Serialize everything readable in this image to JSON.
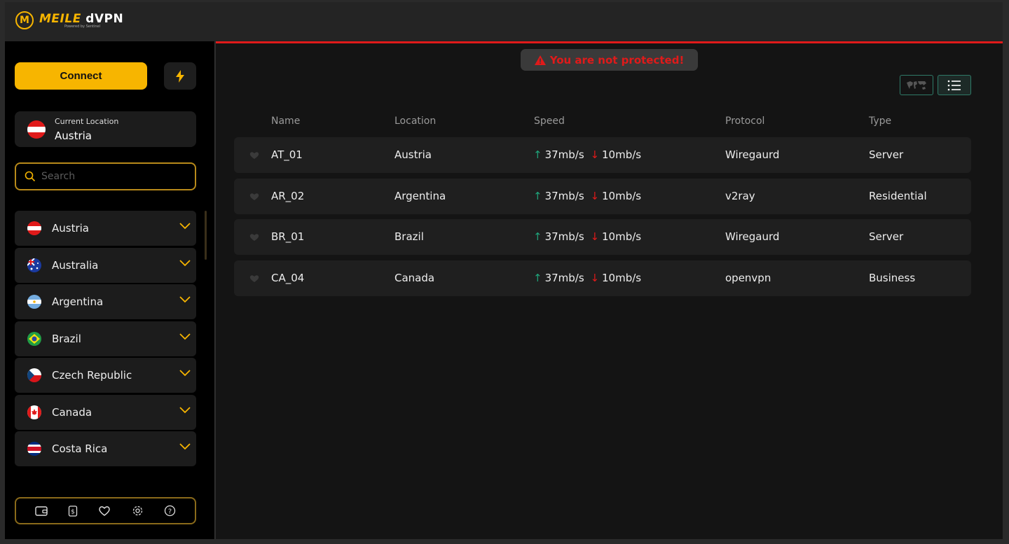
{
  "app": {
    "logo_letter": "M",
    "brand_left": "MEILE",
    "brand_right": "dVPN",
    "tagline": "Powered by Sentinel"
  },
  "sidebar": {
    "connect_label": "Connect",
    "current_location_label": "Current Location",
    "current_location_value": "Austria",
    "search_placeholder": "Search",
    "countries": [
      {
        "name": "Austria"
      },
      {
        "name": "Australia"
      },
      {
        "name": "Argentina"
      },
      {
        "name": "Brazil"
      },
      {
        "name": "Czech Republic"
      },
      {
        "name": "Canada"
      },
      {
        "name": "Costa Rica"
      }
    ],
    "bottom_icons": [
      "wallet-icon",
      "dollar-icon",
      "heart-icon",
      "gear-icon",
      "help-icon"
    ]
  },
  "main": {
    "alert_text": "You are not protected!",
    "columns": {
      "name": "Name",
      "location": "Location",
      "speed": "Speed",
      "protocol": "Protocol",
      "type": "Type"
    },
    "rows": [
      {
        "name": "AT_01",
        "location": "Austria",
        "up": "37mb/s",
        "down": "10mb/s",
        "protocol": "Wiregaurd",
        "type": "Server"
      },
      {
        "name": "AR_02",
        "location": "Argentina",
        "up": "37mb/s",
        "down": "10mb/s",
        "protocol": "v2ray",
        "type": "Residential"
      },
      {
        "name": "BR_01",
        "location": "Brazil",
        "up": "37mb/s",
        "down": "10mb/s",
        "protocol": "Wiregaurd",
        "type": "Server"
      },
      {
        "name": "CA_04",
        "location": "Canada",
        "up": "37mb/s",
        "down": "10mb/s",
        "protocol": "openvpn",
        "type": "Business"
      }
    ]
  },
  "colors": {
    "accent": "#f7b500",
    "alert": "#e01a1a",
    "up": "#1fa37a",
    "view_toggle": "#2f7a68"
  }
}
